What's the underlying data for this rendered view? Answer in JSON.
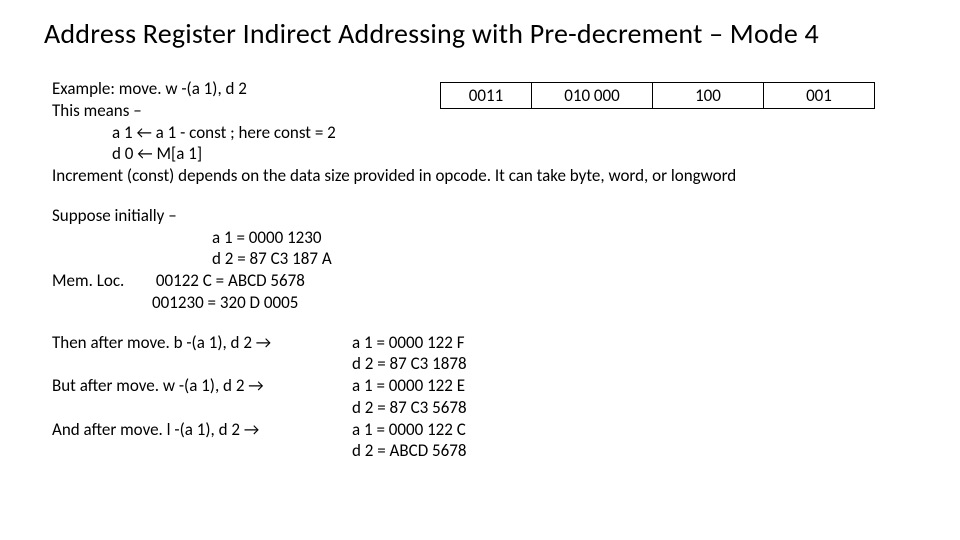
{
  "title": "Address Register Indirect Addressing with Pre-decrement – Mode 4",
  "example_label": "Example:  move. w -(a 1), d 2",
  "this_means": "This means –",
  "step1": "a 1 ← a 1 - const   ; here const = 2",
  "step2": "d 0 ← M[a 1]",
  "increment_line": "Increment (const) depends on the data size provided in opcode. It can take byte, word, or longword",
  "opcode": {
    "f0": "0011",
    "f1": "010 000",
    "f2": "100",
    "f3": "001"
  },
  "suppose": "Suppose initially –",
  "init": {
    "a1": "a 1 = 0000 1230",
    "d2": "d 2 = 87 C3 187 A",
    "memloc_label": "Mem. Loc.",
    "m1": "00122 C = ABCD 5678",
    "m2": "001230 = 320 D 0005"
  },
  "then_b": "Then after move. b -(a 1), d 2 →",
  "res_b_a1": "a 1 = 0000 122 F",
  "res_b_d2": "d 2 = 87 C3 1878",
  "but_w": "But after move. w -(a 1), d 2 →",
  "res_w_a1": "a 1 = 0000 122 E",
  "res_w_d2": "d 2 = 87 C3 5678",
  "and_l": "And after move. l -(a 1), d 2 →",
  "res_l_a1": "a 1 = 0000 122 C",
  "res_l_d2": "d 2 = ABCD 5678"
}
